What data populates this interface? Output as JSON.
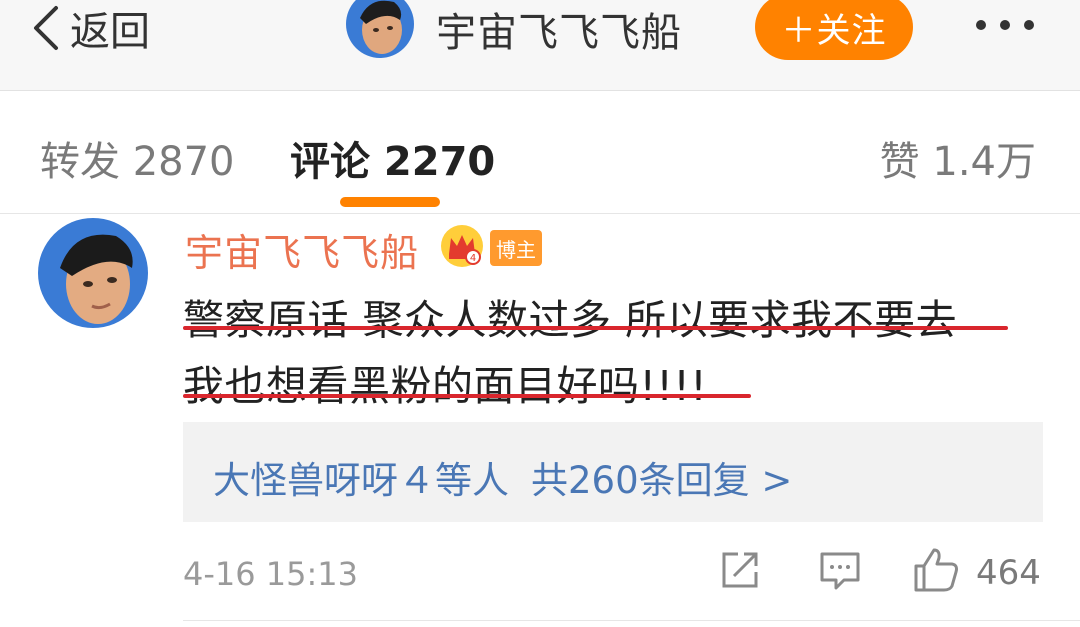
{
  "topbar": {
    "back_label": "返回",
    "title": "宇宙飞飞飞船",
    "follow_label": "＋关注",
    "more_icon": "more-dots-icon"
  },
  "tabs": {
    "repost": "转发 2870",
    "comment": "评论 2270",
    "like": "赞 1.4万"
  },
  "colors": {
    "accent": "#ff8200",
    "username": "#eb7350",
    "link": "#4a77b5",
    "underline": "#d9262d"
  },
  "comment": {
    "username": "宇宙飞飞飞船",
    "badge": "博主",
    "line1": "警察原话 聚众人数过多 所以要求我不要去",
    "line2": "我也想看黑粉的面目好吗!!!!",
    "replies": {
      "names": "大怪兽呀呀４等人",
      "count": "共260条回复 >"
    },
    "time": "4-16 15:13",
    "like_count": "464"
  }
}
